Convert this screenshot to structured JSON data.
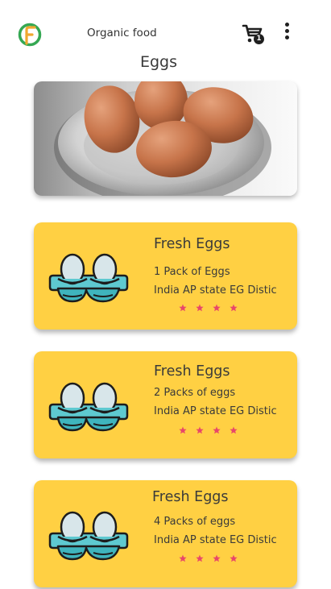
{
  "app": {
    "title": "Organic food",
    "cart_count": "1"
  },
  "page": {
    "title": "Eggs"
  },
  "products": [
    {
      "name": "Fresh Eggs",
      "quantity": "1 Pack of Eggs",
      "location": "India AP state EG Distic",
      "rating": 4
    },
    {
      "name": "Fresh Eggs",
      "quantity": "2 Packs of eggs",
      "location": "India AP state EG Distic",
      "rating": 4
    },
    {
      "name": "Fresh Eggs",
      "quantity": "4 Packs of eggs",
      "location": "India AP state EG Distic",
      "rating": 4
    }
  ],
  "icons": {
    "logo": "organic-food-logo-icon",
    "cart": "shopping-cart-icon",
    "menu": "more-vertical-icon",
    "product": "egg-tray-icon",
    "rating": "star-icon"
  },
  "colors": {
    "card_background": "#ffd043",
    "tray": "#5ec9d0",
    "star": "#e8476a",
    "logo_green": "#35a853",
    "logo_orange": "#f0a830"
  }
}
